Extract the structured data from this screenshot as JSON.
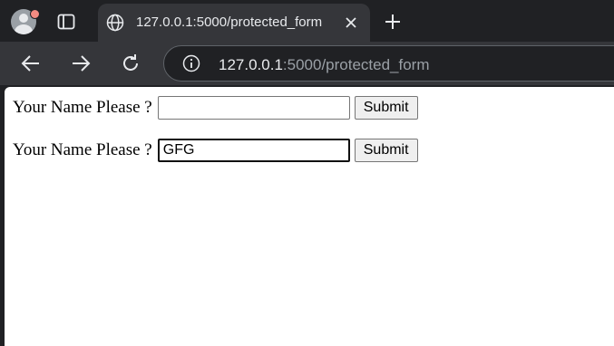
{
  "browser": {
    "tab": {
      "title": "127.0.0.1:5000/protected_form",
      "close_icon": "close-icon",
      "favicon": "globe-icon"
    },
    "new_tab_icon": "plus-icon",
    "profile_icon": "avatar-icon",
    "tab_search_icon": "tab-search-icon",
    "nav": {
      "back_icon": "back-arrow-icon",
      "forward_icon": "forward-arrow-icon",
      "reload_icon": "reload-icon"
    },
    "address": {
      "host": "127.0.0.1",
      "rest": ":5000/protected_form",
      "info_icon": "info-icon"
    },
    "colors": {
      "frame": "#202124",
      "toolbar": "#35363a",
      "text": "#e8eaed",
      "muted": "#9aa0a6"
    }
  },
  "forms": [
    {
      "label": "Your Name Please ?",
      "value": "",
      "button": "Submit"
    },
    {
      "label": "Your Name Please ?",
      "value": "GFG",
      "button": "Submit"
    }
  ]
}
